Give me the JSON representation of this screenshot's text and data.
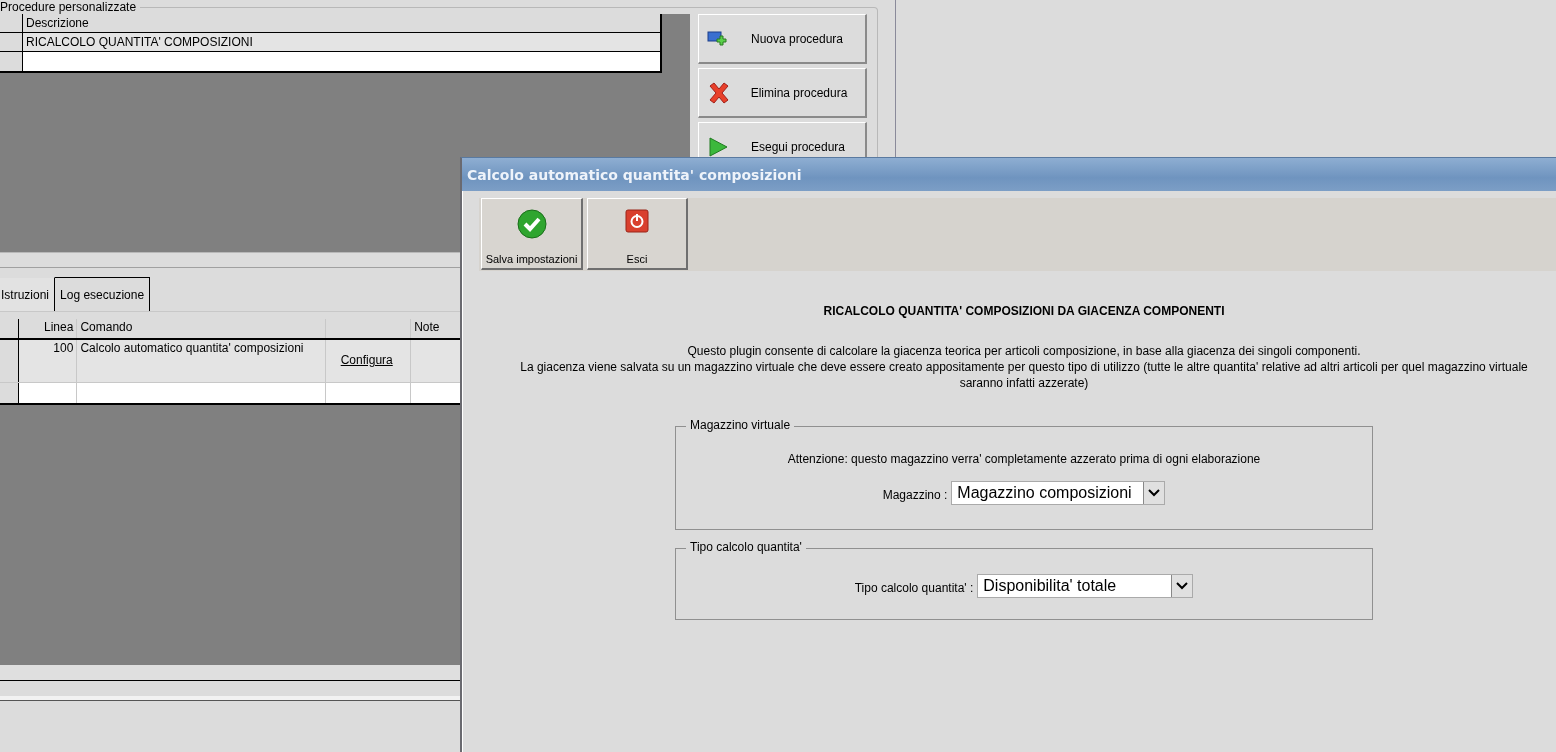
{
  "background": {
    "group_title": "Procedure personalizzate",
    "procedures_table": {
      "columns": [
        "Descrizione"
      ],
      "rows": [
        {
          "cells": [
            "RICALCOLO QUANTITA' COMPOSIZIONI"
          ],
          "selected": true
        }
      ]
    },
    "actions": [
      {
        "label": "Nuova procedura",
        "kind": "add"
      },
      {
        "label": "Elimina procedura",
        "kind": "delete"
      },
      {
        "label": "Esegui procedura",
        "kind": "run"
      }
    ],
    "tabs": [
      {
        "label": "Istruzioni",
        "selected": true
      },
      {
        "label": "Log esecuzione",
        "selected": false
      }
    ],
    "instructions_table": {
      "columns": [
        {
          "kind": "number",
          "label": "Linea"
        },
        {
          "kind": "text",
          "label": "Comando"
        },
        {
          "kind": "action"
        },
        {
          "kind": "text",
          "label": "Note"
        }
      ],
      "rows": [
        {
          "cells": [
            "100",
            "Calcolo automatico quantita' composizioni",
            "Configura",
            null
          ]
        }
      ]
    }
  },
  "dialog": {
    "title": "Calcolo automatico quantita' composizioni",
    "toolbar": [
      {
        "label": "Salva impostazioni",
        "kind": "save"
      },
      {
        "label": "Esci",
        "kind": "exit"
      }
    ],
    "heading": "RICALCOLO QUANTITA' COMPOSIZIONI DA GIACENZA COMPONENTI",
    "description": [
      "Questo plugin consente di calcolare la giacenza teorica per articoli composizione, in base alla giacenza dei singoli componenti.",
      "La giacenza viene salvata su un magazzino virtuale che deve essere creato appositamente per questo tipo di utilizzo (tutte le altre quantita' relative ad altri articoli per quel magazzino virtuale saranno infatti azzerate)"
    ],
    "groups": [
      {
        "title": "Magazzino virtuale",
        "note": "Attenzione: questo magazzino verra' completamente azzerato prima di ogni elaborazione",
        "field": {
          "label": "Magazzino :",
          "value": "Magazzino composizioni"
        }
      },
      {
        "title": "Tipo calcolo quantita'",
        "field": {
          "label": "Tipo calcolo quantita' :",
          "value": "Disponibilita' totale"
        }
      }
    ]
  }
}
